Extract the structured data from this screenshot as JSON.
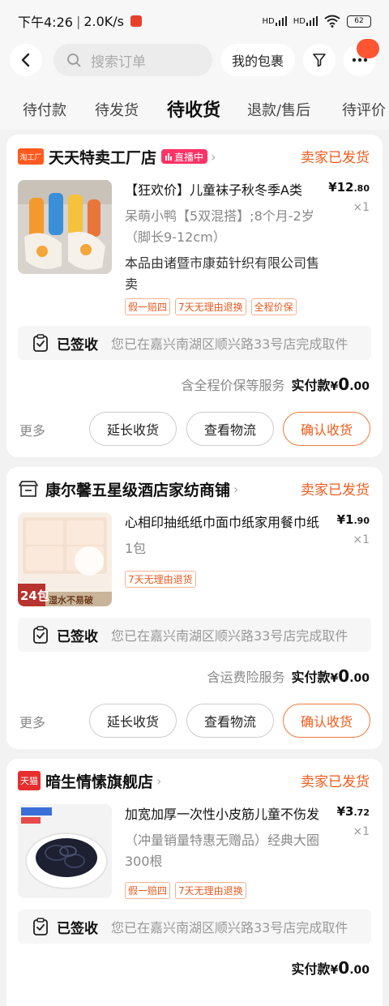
{
  "status_bar": {
    "time": "下午4:26",
    "speed": "2.0K/s",
    "battery": "62",
    "signal1": "HD",
    "signal2": "HD"
  },
  "search": {
    "placeholder": "搜索订单",
    "my_package": "我的包裹"
  },
  "tabs": [
    {
      "label": "待付款",
      "active": false
    },
    {
      "label": "待发货",
      "active": false
    },
    {
      "label": "待收货",
      "active": true
    },
    {
      "label": "退款/售后",
      "active": false
    },
    {
      "label": "待评价",
      "active": false
    }
  ],
  "orders": [
    {
      "shop_logo_text": "淘工厂",
      "shop_name": "天天特卖工厂店",
      "live_badge": "直播中",
      "status": "卖家已发货",
      "title": "【狂欢价】儿童袜子秋冬季A类",
      "spec": "呆萌小鸭【5双混搭】;8个月-2岁（脚长9-12cm）",
      "seller_note": "本品由诸暨市康茹针织有限公司售卖",
      "price_int": "¥12",
      "price_dec": ".80",
      "qty": "×1",
      "tags": [
        "假一赔四",
        "7天无理由退换",
        "全程价保"
      ],
      "track_label": "已签收",
      "track_text": "您已在嘉兴南湖区顺兴路33号店完成取件",
      "service": "含全程价保等服务",
      "paid_label": "实付款",
      "paid_cur": "¥",
      "paid_int": "0",
      "paid_dec": ".00",
      "more": "更多",
      "buttons": [
        "延长收货",
        "查看物流",
        "确认收货"
      ]
    },
    {
      "shop_logo_text": "",
      "shop_name": "康尔馨五星级酒店家纺商铺",
      "status": "卖家已发货",
      "title": "心相印抽纸纸巾面巾纸家用餐巾纸",
      "spec": "1包",
      "price_int": "¥1",
      "price_dec": ".90",
      "qty": "×1",
      "tags": [
        "7天无理由退货"
      ],
      "thumb_text": "24包",
      "thumb_sub": "湿水不易破",
      "track_label": "已签收",
      "track_text": "您已在嘉兴南湖区顺兴路33号店完成取件",
      "service": "含运费险服务",
      "paid_label": "实付款",
      "paid_cur": "¥",
      "paid_int": "0",
      "paid_dec": ".00",
      "more": "更多",
      "buttons": [
        "延长收货",
        "查看物流",
        "确认收货"
      ]
    },
    {
      "shop_logo_text": "天猫",
      "shop_name": "暗生情愫旗舰店",
      "status": "卖家已发货",
      "title": "加宽加厚一次性小皮筋儿童不伤发",
      "spec": "（冲量销量特惠无赠品）经典大圈300根",
      "price_int": "¥3",
      "price_dec": ".72",
      "qty": "×1",
      "tags": [
        "假一赔四",
        "7天无理由退换"
      ],
      "track_label": "已签收",
      "track_text": "您已在嘉兴南湖区顺兴路33号店完成取件",
      "paid_label": "实付款",
      "paid_cur": "¥",
      "paid_int": "0",
      "paid_dec": ".00"
    }
  ],
  "colors": {
    "accent": "#f05a1a",
    "live": "#ff3366",
    "tmall": "#e62e2e",
    "taogongchang": "#ff5a1f"
  }
}
